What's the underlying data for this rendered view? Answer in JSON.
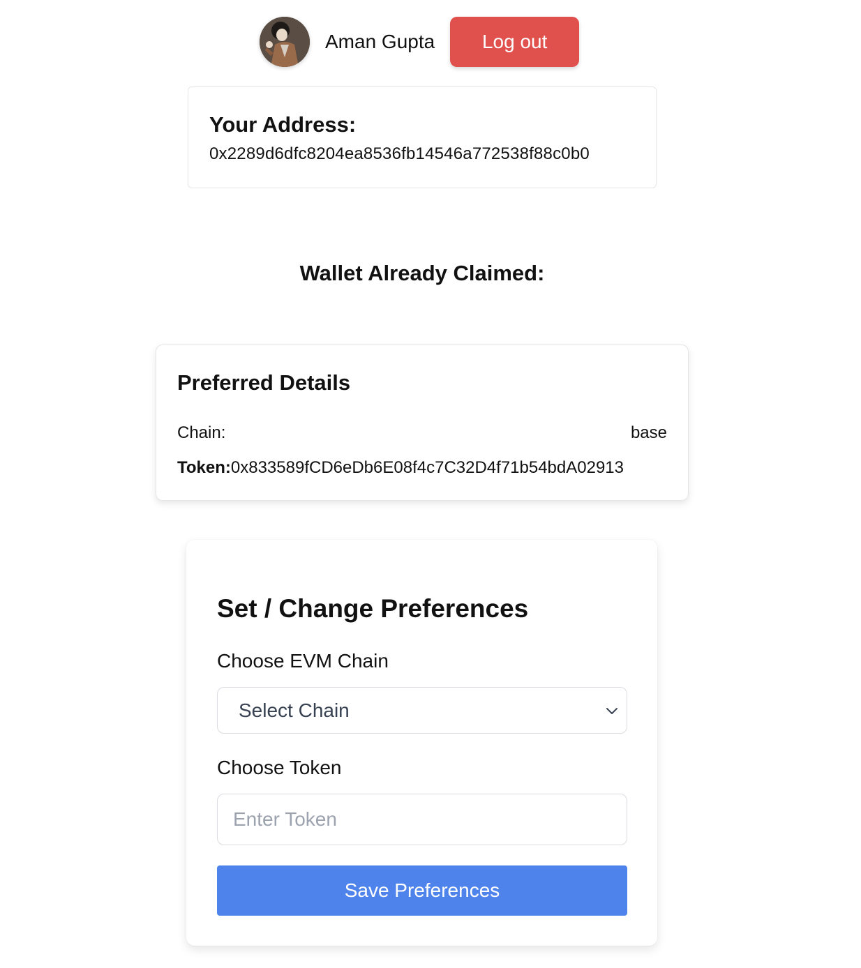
{
  "header": {
    "user_name": "Aman Gupta",
    "logout_label": "Log out",
    "logout_color": "#e0514e"
  },
  "address": {
    "label": "Your Address:",
    "value": "0x2289d6dfc8204ea8536fb14546a772538f88c0b0"
  },
  "status": {
    "heading": "Wallet Already Claimed:"
  },
  "preferred": {
    "title": "Preferred Details",
    "chain_key": "Chain:",
    "chain_value": "base",
    "token_key": "Token:",
    "token_value": "0x833589fCD6eDb6E08f4c7C32D4f71b54bdA02913"
  },
  "preferences_form": {
    "title": "Set / Change Preferences",
    "chain_label": "Choose EVM Chain",
    "chain_select_value": "Select Chain",
    "token_label": "Choose Token",
    "token_placeholder": "Enter Token",
    "token_value": "",
    "save_label": "Save Preferences",
    "save_color": "#4f83ec"
  },
  "icons": [
    "avatar-image",
    "chevron-down-icon"
  ]
}
